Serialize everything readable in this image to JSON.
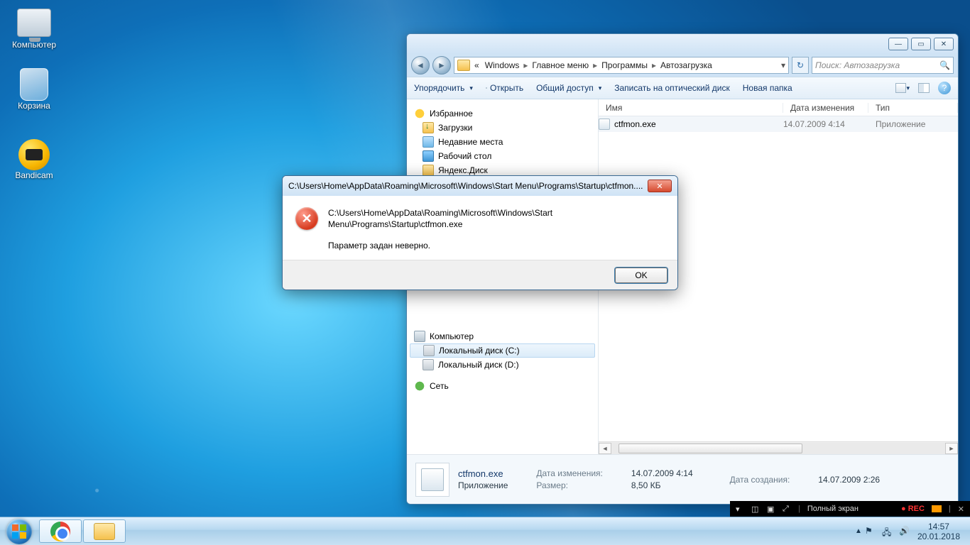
{
  "desktop": {
    "icons": [
      {
        "label": "Компьютер"
      },
      {
        "label": "Корзина"
      },
      {
        "label": "Bandicam"
      }
    ]
  },
  "explorer": {
    "breadcrumb_lead": "«",
    "breadcrumbs": [
      "Windows",
      "Главное меню",
      "Программы",
      "Автозагрузка"
    ],
    "search_placeholder": "Поиск: Автозагрузка",
    "toolbar": {
      "organize": "Упорядочить",
      "open": "Открыть",
      "share": "Общий доступ",
      "burn": "Записать на оптический диск",
      "newfolder": "Новая папка"
    },
    "nav": {
      "favorites": "Избранное",
      "downloads": "Загрузки",
      "recent": "Недавние места",
      "desktop": "Рабочий стол",
      "yadisk": "Яндекс.Диск",
      "computer": "Компьютер",
      "disk_c": "Локальный диск (C:)",
      "disk_d": "Локальный диск (D:)",
      "network": "Сеть"
    },
    "columns": {
      "name": "Имя",
      "date": "Дата изменения",
      "type": "Тип"
    },
    "rows": [
      {
        "name": "ctfmon.exe",
        "date": "14.07.2009 4:14",
        "type": "Приложение"
      }
    ],
    "details": {
      "filename": "ctfmon.exe",
      "filetype": "Приложение",
      "k_modified": "Дата изменения:",
      "v_modified": "14.07.2009 4:14",
      "k_size": "Размер:",
      "v_size": "8,50 КБ",
      "k_created": "Дата создания:",
      "v_created": "14.07.2009 2:26"
    }
  },
  "dialog": {
    "title": "C:\\Users\\Home\\AppData\\Roaming\\Microsoft\\Windows\\Start Menu\\Programs\\Startup\\ctfmon....",
    "path": "C:\\Users\\Home\\AppData\\Roaming\\Microsoft\\Windows\\Start Menu\\Programs\\Startup\\ctfmon.exe",
    "message": "Параметр задан неверно.",
    "ok": "OK"
  },
  "bandicam": {
    "label": "Полный экран",
    "rec": "REC"
  },
  "tray": {
    "time": "14:57",
    "date": "20.01.2018"
  }
}
